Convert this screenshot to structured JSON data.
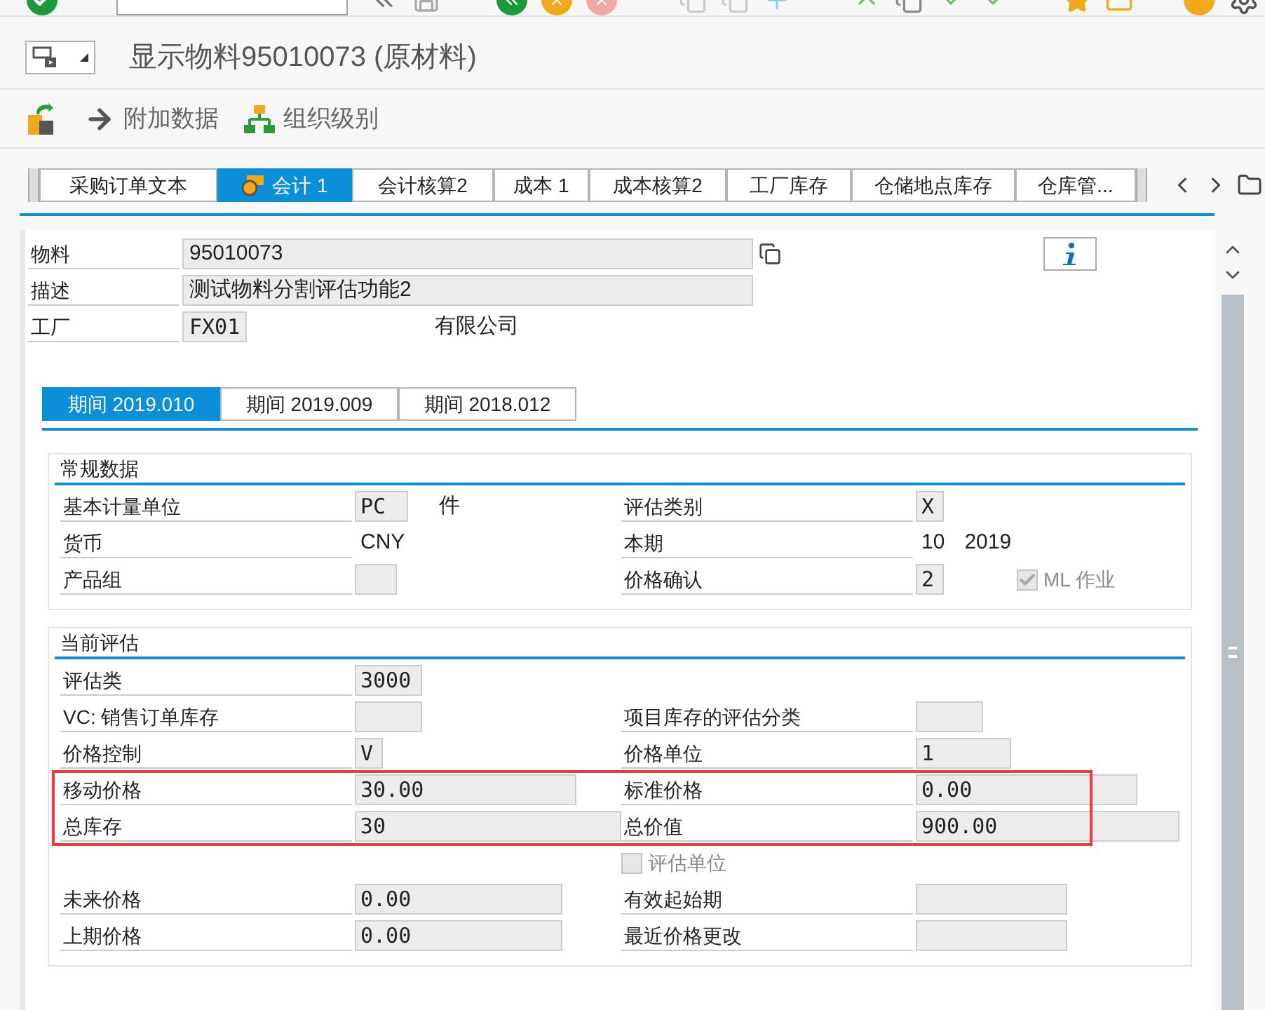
{
  "title": "显示物料95010073 (原材料)",
  "app_toolbar": [
    {
      "label": "附加数据"
    },
    {
      "label": "组织级别"
    }
  ],
  "tabs": [
    {
      "label": "采购订单文本",
      "selected": false
    },
    {
      "label": "会计 1",
      "selected": true
    },
    {
      "label": "会计核算2",
      "selected": false
    },
    {
      "label": "成本 1",
      "selected": false
    },
    {
      "label": "成本核算2",
      "selected": false
    },
    {
      "label": "工厂库存",
      "selected": false
    },
    {
      "label": "仓储地点库存",
      "selected": false
    },
    {
      "label": "仓库管...",
      "selected": false
    }
  ],
  "header": [
    {
      "label": "物料",
      "value": "95010073"
    },
    {
      "label": "描述",
      "value": "测试物料分割评估功能2"
    },
    {
      "label": "工厂",
      "value": "FX01",
      "text": "有限公司"
    }
  ],
  "period_tabs": [
    {
      "label": "期间 2019.010",
      "selected": true
    },
    {
      "label": "期间 2019.009",
      "selected": false
    },
    {
      "label": "期间 2018.012",
      "selected": false
    }
  ],
  "groups": [
    {
      "title": "常规数据",
      "rows": [
        {
          "highlighted": false,
          "left": {
            "kind": "field",
            "label": "基本计量单位",
            "value": "PC",
            "unit": "件"
          },
          "right": {
            "kind": "field",
            "label": "评估类别",
            "value": "X"
          }
        },
        {
          "highlighted": false,
          "left": {
            "kind": "text",
            "label": "货币",
            "value": "CNY"
          },
          "right": {
            "kind": "text",
            "label": "本期",
            "value": "10",
            "unit": "2019"
          }
        },
        {
          "highlighted": false,
          "left": {
            "kind": "field",
            "label": "产品组"
          },
          "right": {
            "kind": "field",
            "label": "价格确认",
            "value": "2",
            "check": {
              "label": "ML 作业",
              "checked": true,
              "disabled": true
            }
          }
        }
      ]
    },
    {
      "title": "当前评估",
      "rows": [
        {
          "highlighted": false,
          "left": {
            "kind": "field",
            "label": "评估类",
            "value": "3000"
          }
        },
        {
          "highlighted": false,
          "left": {
            "kind": "field",
            "label": "VC: 销售订单库存"
          },
          "right": {
            "kind": "field",
            "label": "项目库存的评估分类"
          }
        },
        {
          "highlighted": false,
          "left": {
            "kind": "field",
            "label": "价格控制",
            "value": "V"
          },
          "right": {
            "kind": "field",
            "label": "价格单位",
            "value": "1"
          }
        },
        {
          "highlighted": true,
          "left": {
            "kind": "field",
            "label": "移动价格",
            "value": "30.00"
          },
          "right": {
            "kind": "field",
            "label": "标准价格",
            "value": "0.00"
          }
        },
        {
          "highlighted": true,
          "left": {
            "kind": "field",
            "label": "总库存",
            "value": "30"
          },
          "right": {
            "kind": "field",
            "label": "总价值",
            "value": "900.00"
          }
        },
        {
          "highlighted": false,
          "right": {
            "kind": "checkbox",
            "label": "评估单位",
            "checked": false,
            "disabled": true
          }
        },
        {
          "highlighted": false,
          "left": {
            "kind": "field",
            "label": "未来价格",
            "value": "0.00"
          },
          "right": {
            "kind": "field",
            "label": "有效起始期"
          }
        },
        {
          "highlighted": false,
          "left": {
            "kind": "field",
            "label": "上期价格",
            "value": "0.00"
          },
          "right": {
            "kind": "field",
            "label": "最近价格更改"
          }
        }
      ]
    }
  ]
}
